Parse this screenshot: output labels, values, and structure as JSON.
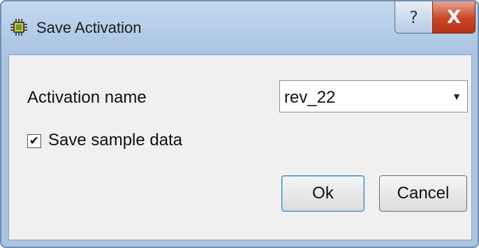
{
  "window": {
    "title": "Save Activation",
    "app_icon": "chip-icon",
    "help_label": "?",
    "close_label": "X"
  },
  "form": {
    "activation_name_label": "Activation name",
    "activation_name_value": "rev_22",
    "save_sample_label": "Save sample data",
    "save_sample_checked": true
  },
  "buttons": {
    "ok_label": "Ok",
    "cancel_label": "Cancel"
  },
  "colors": {
    "titlebar": "#b5cde8",
    "close_button": "#c9452a",
    "client": "#f0f0f0"
  }
}
